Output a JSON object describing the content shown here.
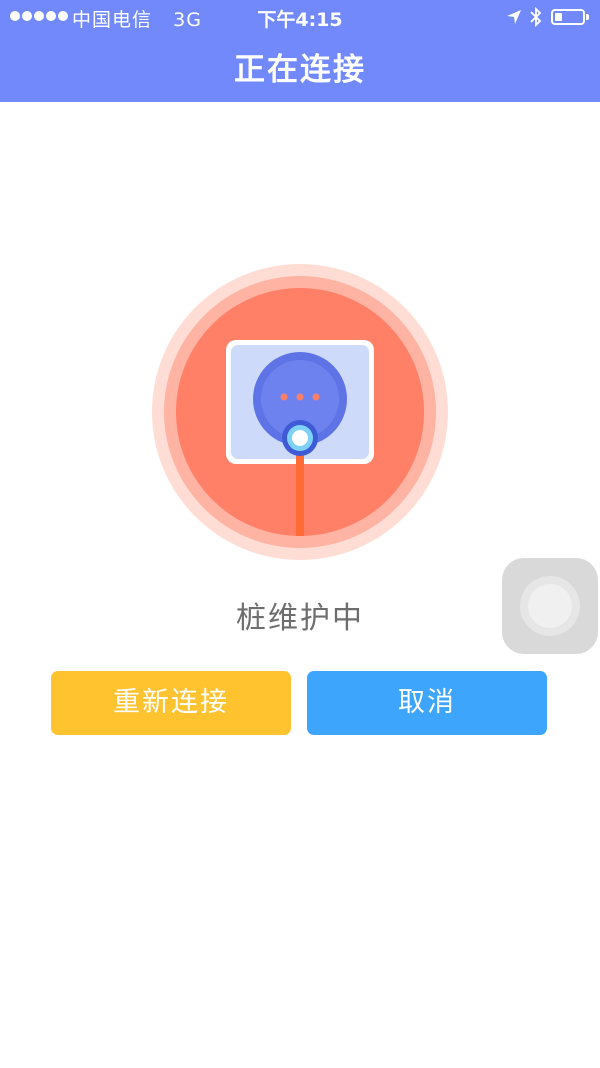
{
  "status_bar": {
    "carrier": "中国电信",
    "network": "3G",
    "time": "下午4:15",
    "icons": [
      "signal-dots-icon",
      "location-arrow-icon",
      "bluetooth-icon",
      "battery-icon"
    ]
  },
  "header": {
    "title": "正在连接"
  },
  "main": {
    "illustration": "charging-pile-plug-icon",
    "status_text": "桩维护中"
  },
  "actions": {
    "reconnect_label": "重新连接",
    "cancel_label": "取消"
  },
  "colors": {
    "header_bg": "#7289fb",
    "circle_main": "#ff7f67",
    "reconnect_bg": "#fec32f",
    "cancel_bg": "#3ea5fc"
  }
}
